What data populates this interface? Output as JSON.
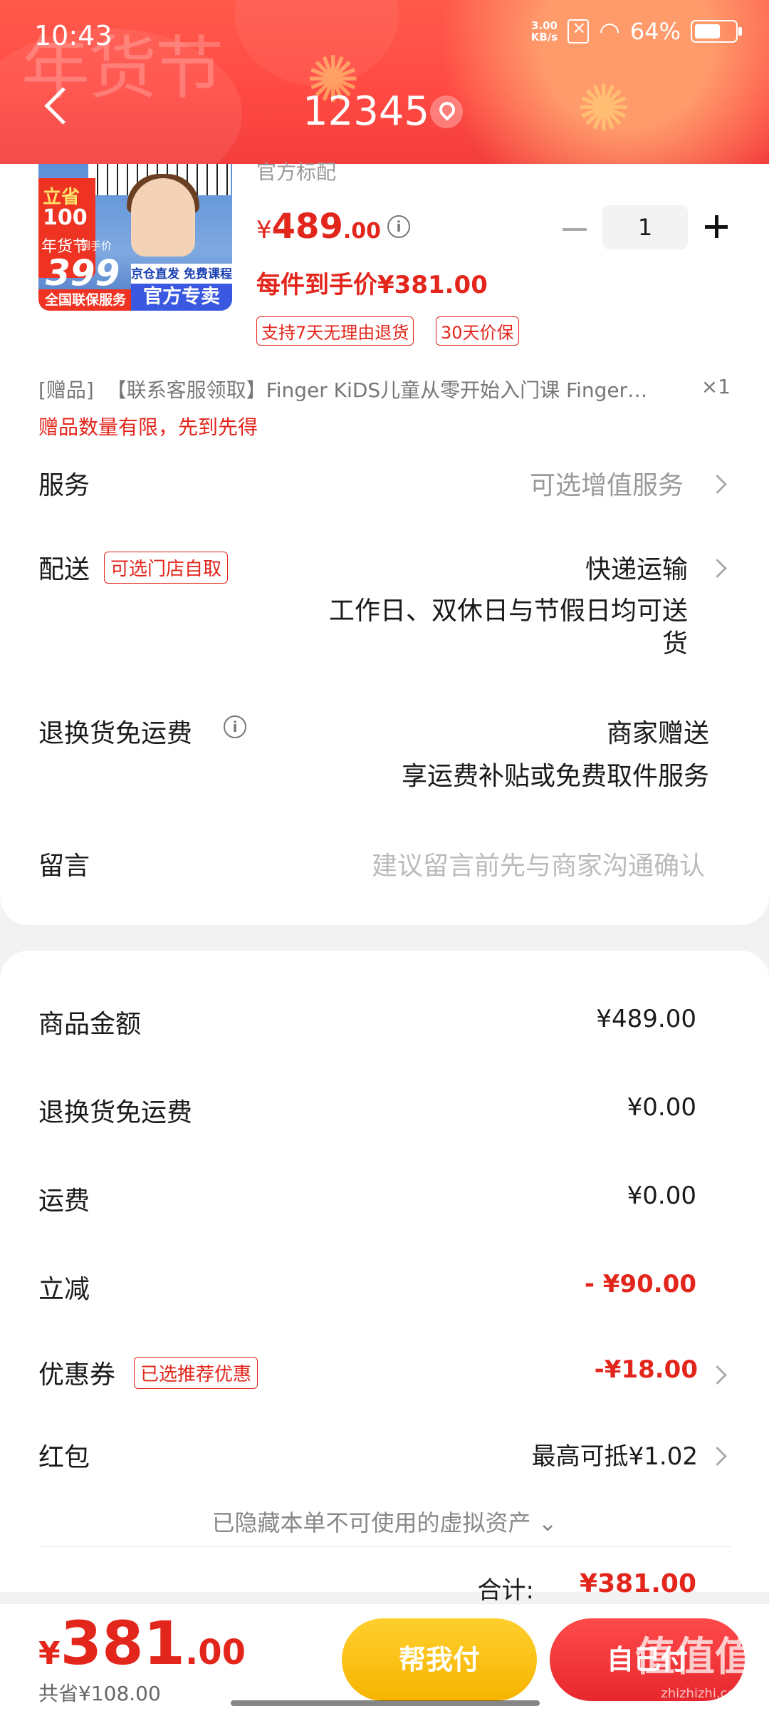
{
  "status": {
    "time": "10:43",
    "net_speed": "3.00",
    "net_unit": "KB/s",
    "battery": "64%",
    "battery_level": 0.64
  },
  "header": {
    "watermark": "年货节",
    "title": "12345"
  },
  "product": {
    "spec": "官方标配",
    "price_currency": "¥",
    "price_int": "489",
    "price_dec": ".00",
    "quantity": "1",
    "hand_price": "每件到手价¥381.00",
    "tags": [
      "支持7天无理由退货",
      "30天价保"
    ],
    "image_badges": {
      "t1": "立省",
      "t2": "100",
      "t3": "年货节",
      "t4": "到手价",
      "price": "399",
      "service": "全国联保服务",
      "jd": "京仓直发 免费课程",
      "official": "官方专卖"
    }
  },
  "gift": {
    "prefix": "[赠品]",
    "name": "【联系客服领取】Finger KiDS儿童从零开始入门课 Finger…",
    "qty": "×1",
    "note": "赠品数量有限，先到先得"
  },
  "rows": {
    "service": {
      "label": "服务",
      "value": "可选增值服务"
    },
    "delivery": {
      "label": "配送",
      "tag": "可选门店自取",
      "value": "快递运输",
      "detail_1": "工作日、双休日与节假日均可送",
      "detail_2": "货"
    },
    "return": {
      "label": "退换货免运费",
      "value": "商家赠送",
      "detail": "享运费补贴或免费取件服务"
    },
    "message": {
      "label": "留言",
      "placeholder": "建议留言前先与商家沟通确认"
    }
  },
  "summary": {
    "goods": {
      "label": "商品金额",
      "value": "¥489.00"
    },
    "return_fee": {
      "label": "退换货免运费",
      "value": "¥0.00"
    },
    "shipping": {
      "label": "运费",
      "value": "¥0.00"
    },
    "discount": {
      "label": "立减",
      "value": "- ¥90.00"
    },
    "coupon": {
      "label": "优惠券",
      "tag": "已选推荐优惠",
      "value": "-¥18.00"
    },
    "redpacket": {
      "label": "红包",
      "value": "最高可抵¥1.02"
    },
    "hidden_assets": "已隐藏本单不可使用的虚拟资产",
    "total_label": "合计:",
    "total_value": "¥381.00"
  },
  "bottom": {
    "price_currency": "¥",
    "price_int": "381",
    "price_dec": ".00",
    "saved": "共省¥108.00",
    "help_pay": "帮我付",
    "self_pay": "自己付"
  },
  "corner_watermark": {
    "main": "值值值",
    "sub": "zhizhizhi.com"
  },
  "colors": {
    "accent": "#e3261c",
    "header": "#ff4a43",
    "help_btn": "#f7b400",
    "self_btn": "#e6282e"
  }
}
